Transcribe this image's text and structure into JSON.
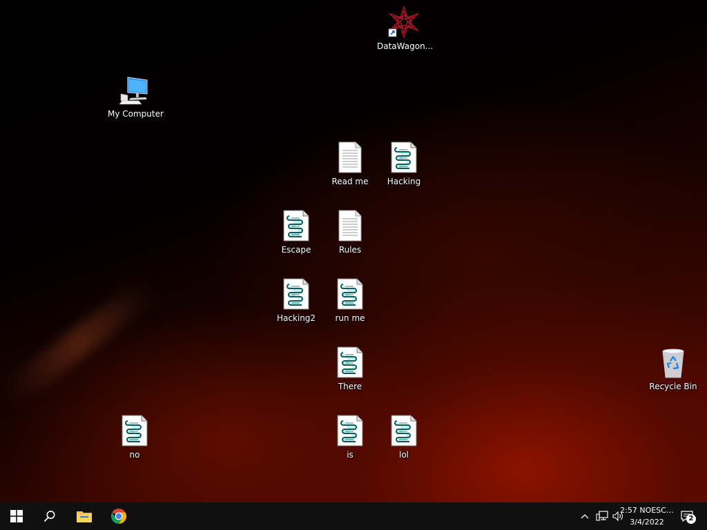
{
  "desktop": {
    "icons": {
      "datawagon": {
        "label": "DataWagon..."
      },
      "my_computer": {
        "label": "My Computer"
      },
      "read_me": {
        "label": "Read me"
      },
      "hacking": {
        "label": "Hacking"
      },
      "escape": {
        "label": "Escape"
      },
      "rules": {
        "label": "Rules"
      },
      "hacking2": {
        "label": "Hacking2"
      },
      "run_me": {
        "label": "run me"
      },
      "there": {
        "label": "There"
      },
      "no": {
        "label": "no"
      },
      "is": {
        "label": "is"
      },
      "lol": {
        "label": "lol"
      },
      "recycle_bin": {
        "label": "Recycle Bin"
      }
    }
  },
  "taskbar": {
    "pinned": [
      "start-icon",
      "search-icon",
      "file-explorer-icon",
      "chrome-icon"
    ],
    "tray": {
      "icons": [
        "chevron-up-icon",
        "network-icon",
        "volume-icon"
      ],
      "clock_time": "2:57 NOESC…",
      "clock_date": "3/4/2022",
      "notification_count": "2"
    }
  },
  "colors": {
    "taskbar_bg": "#101010",
    "start_blue": "#ffffff",
    "folder_yellow": "#f2c34b",
    "chrome_red": "#db4437",
    "chrome_yellow": "#f4b400",
    "chrome_green": "#0f9d58",
    "chrome_blue": "#4285f4"
  }
}
